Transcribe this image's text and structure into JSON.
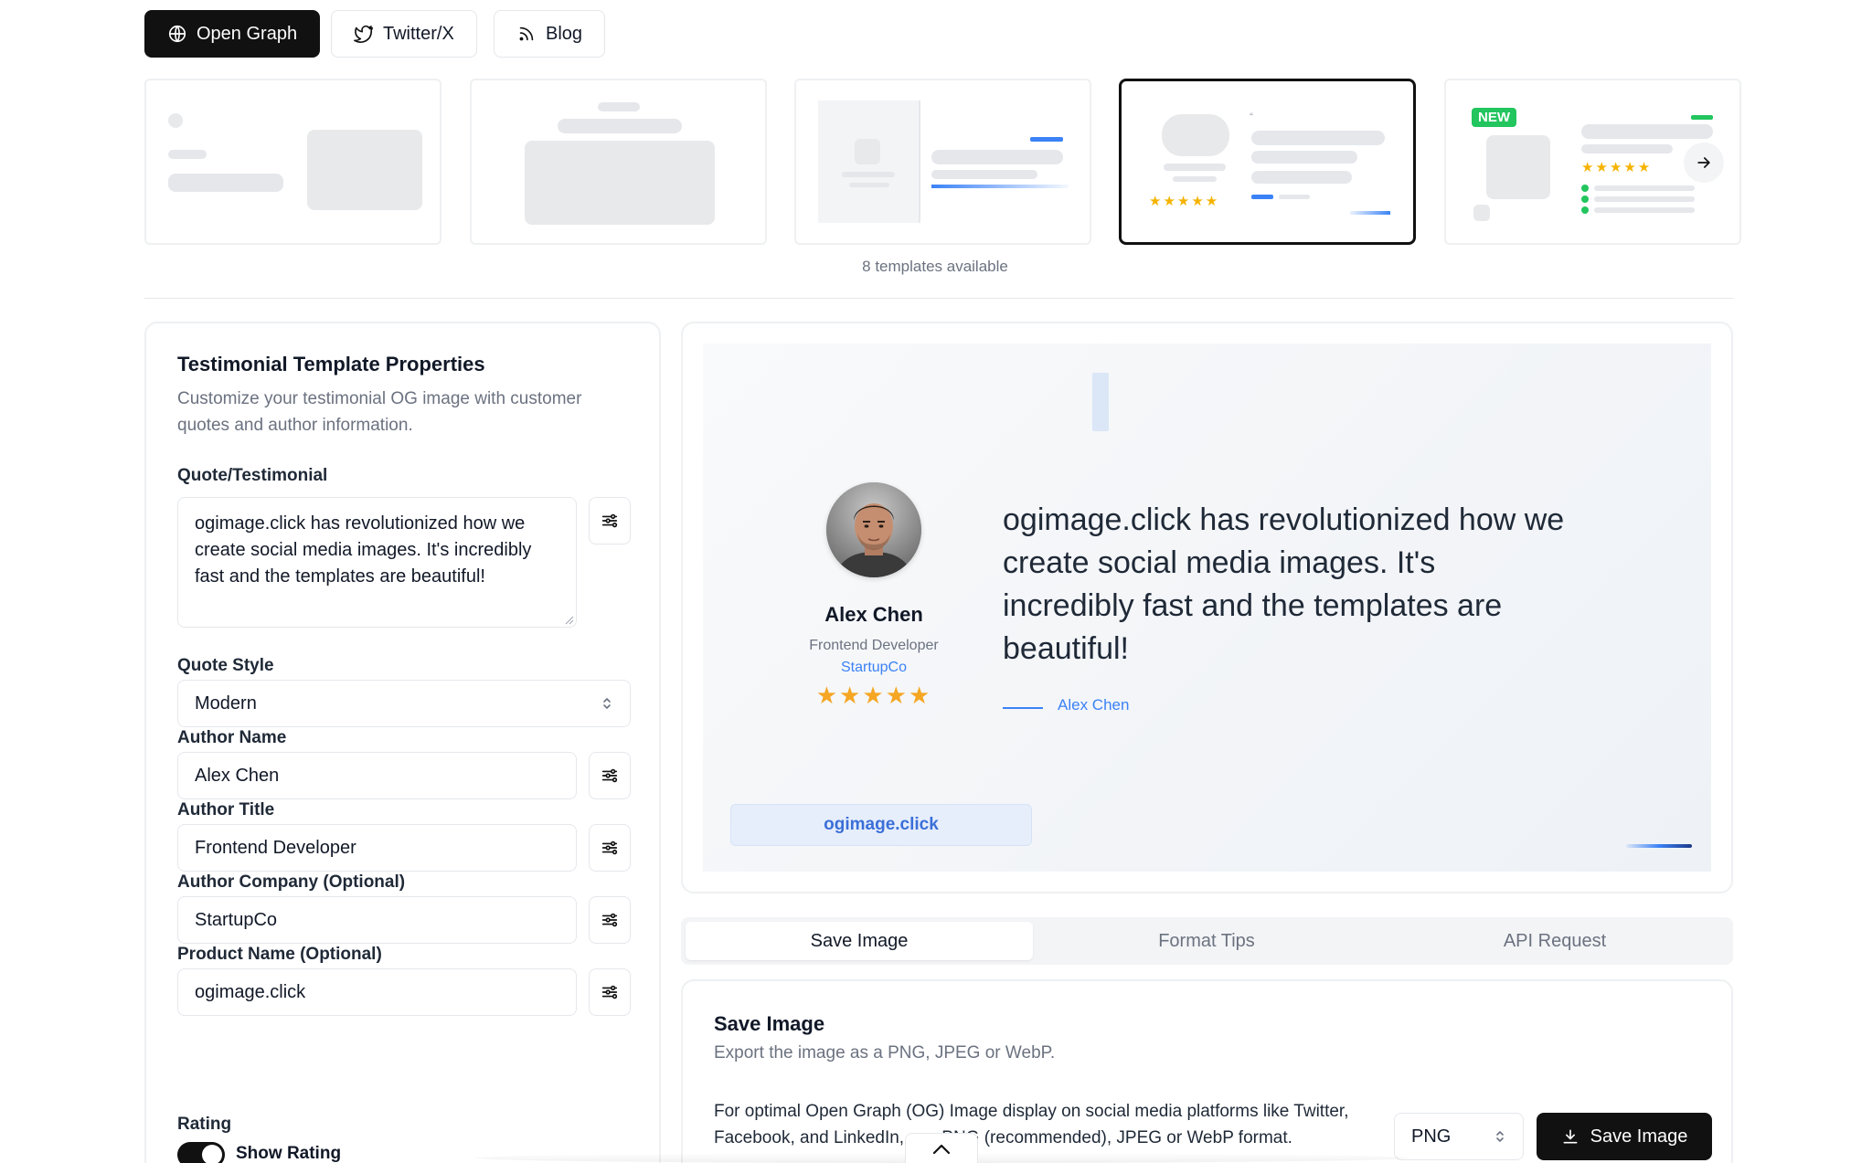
{
  "top_tabs": [
    {
      "label": "Open Graph",
      "icon": "globe-icon",
      "active": true
    },
    {
      "label": "Twitter/X",
      "icon": "twitter-bird-icon",
      "active": false
    },
    {
      "label": "Blog",
      "icon": "rss-icon",
      "active": false
    }
  ],
  "templates": {
    "count_label": "8 templates available",
    "new_badge": "NEW",
    "selected_index": 3
  },
  "properties": {
    "title": "Testimonial Template Properties",
    "description": "Customize your testimonial OG image with customer quotes and author information.",
    "quote_label": "Quote/Testimonial",
    "quote_value": "ogimage.click has revolutionized how we create social media images. It's incredibly fast and the templates are beautiful!",
    "quote_style_label": "Quote Style",
    "quote_style_value": "Modern",
    "author_name_label": "Author Name",
    "author_name_value": "Alex Chen",
    "author_title_label": "Author Title",
    "author_title_value": "Frontend Developer",
    "author_company_label": "Author Company (Optional)",
    "author_company_value": "StartupCo",
    "product_name_label": "Product Name (Optional)",
    "product_name_value": "ogimage.click",
    "rating_label": "Rating",
    "show_rating_label": "Show Rating",
    "show_rating_on": true
  },
  "preview": {
    "author_name": "Alex Chen",
    "author_title": "Frontend Developer",
    "author_company": "StartupCo",
    "stars": "★★★★★",
    "quote": "ogimage.click has revolutionized how we create social media images. It's incredibly fast and the templates are beautiful!",
    "quote_author": "Alex Chen",
    "product": "ogimage.click"
  },
  "output_tabs": [
    {
      "label": "Save Image",
      "active": true
    },
    {
      "label": "Format Tips",
      "active": false
    },
    {
      "label": "API Request",
      "active": false
    }
  ],
  "save": {
    "title": "Save Image",
    "subtitle": "Export the image as a PNG, JPEG or WebP.",
    "body": "For optimal Open Graph (OG) Image display on social media platforms like Twitter, Facebook, and LinkedIn, use PNG (recommended), JPEG or WebP format.",
    "format_value": "PNG",
    "button_label": "Save Image"
  },
  "colors": {
    "accent": "#3b82f6",
    "dark": "#111111",
    "star": "#f5a623",
    "new_badge": "#22c55e"
  }
}
